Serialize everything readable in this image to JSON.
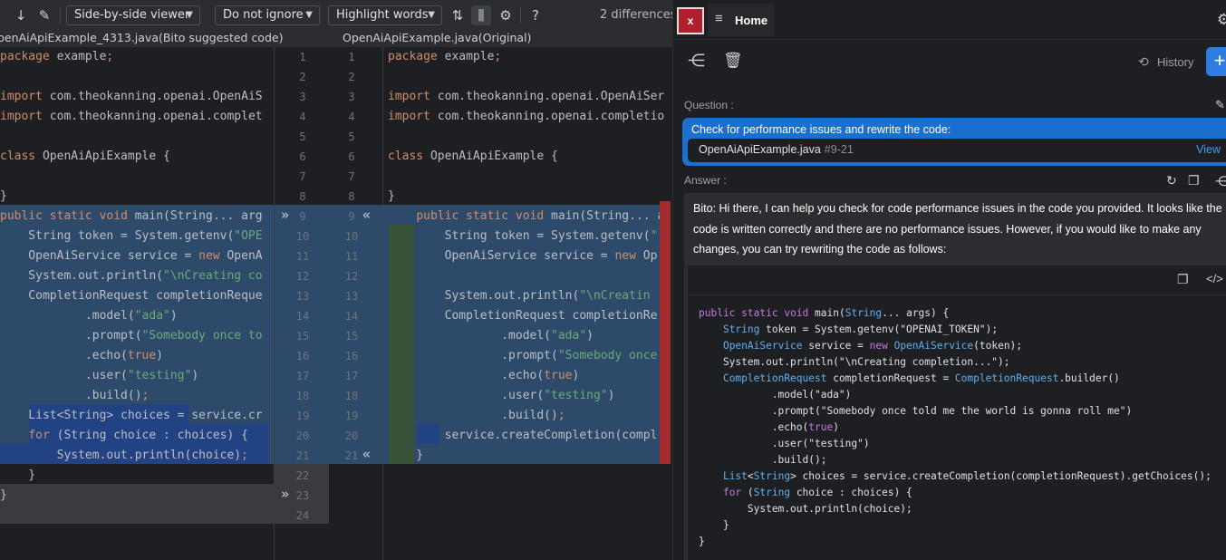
{
  "toolbar": {
    "viewer_select": "Side-by-side viewer",
    "ignore_select": "Do not ignore",
    "highlight_select": "Highlight words",
    "diff_count": "2 differences",
    "help": "?"
  },
  "titles": {
    "left": "penAiApiExample_4313.java(Bito suggested code)",
    "right": "OpenAiApiExample.java(Original)"
  },
  "left_lines": [
    "package example;",
    "",
    "import com.theokanning.openai.OpenAiS",
    "import com.theokanning.openai.complet",
    "",
    "class OpenAiApiExample {",
    "",
    "}",
    "public static void main(String... arg",
    "    String token = System.getenv(\"OPE",
    "    OpenAiService service = new OpenA",
    "    System.out.println(\"\\nCreating co",
    "    CompletionRequest completionReque",
    "            .model(\"ada\")",
    "            .prompt(\"Somebody once to",
    "            .echo(true)",
    "            .user(\"testing\")",
    "            .build();",
    "    List<String> choices = service.cr",
    "    for (String choice : choices) {",
    "        System.out.println(choice);",
    "    }",
    "}"
  ],
  "right_lines": [
    "package example;",
    "",
    "import com.theokanning.openai.OpenAiSer",
    "import com.theokanning.openai.completio",
    "",
    "class OpenAiApiExample {",
    "",
    "}",
    "    public static void main(String... a",
    "        String token = System.getenv(\"",
    "        OpenAiService service = new Op",
    "",
    "        System.out.println(\"\\nCreatin",
    "        CompletionRequest completionRe",
    "                .model(\"ada\")",
    "                .prompt(\"Somebody once",
    "                .echo(true)",
    "                .user(\"testing\")",
    "                .build();",
    "        service.createCompletion(compl",
    "    }"
  ],
  "left_numbers": [
    "1",
    "2",
    "3",
    "4",
    "5",
    "6",
    "7",
    "8",
    "9",
    "10",
    "11",
    "12",
    "13",
    "14",
    "15",
    "16",
    "17",
    "18",
    "19",
    "20",
    "21",
    "22",
    "23",
    "24"
  ],
  "right_numbers": [
    "1",
    "2",
    "3",
    "4",
    "5",
    "6",
    "7",
    "8",
    "9",
    "10",
    "11",
    "12",
    "13",
    "14",
    "15",
    "16",
    "17",
    "18",
    "19",
    "20",
    "21"
  ],
  "chat": {
    "close": "x",
    "home": "Home",
    "history": "History",
    "question_label": "Question :",
    "question": "Check for performance issues and rewrite the code:",
    "file_name": "OpenAiApiExample.java",
    "file_range": "#9-21",
    "view": "View",
    "answer_label": "Answer :",
    "answer_text": "Bito: Hi there, I can help you check for code performance issues in the code you provided. It looks like the code is written correctly and there are no performance issues. However, if you would like to make any changes, you can try rewriting the code as follows:",
    "code": [
      "public static void main(String... args) {",
      "    String token = System.getenv(\"OPENAI_TOKEN\");",
      "    OpenAiService service = new OpenAiService(token);",
      "    System.out.println(\"\\nCreating completion...\");",
      "    CompletionRequest completionRequest = CompletionRequest.builder()",
      "            .model(\"ada\")",
      "            .prompt(\"Somebody once told me the world is gonna roll me\")",
      "            .echo(true)",
      "            .user(\"testing\")",
      "            .build();",
      "    List<String> choices = service.createCompletion(completionRequest).getChoices();",
      "    for (String choice : choices) {",
      "        System.out.println(choice);",
      "    }",
      "}"
    ]
  },
  "colors": {
    "accent": "#2f7de1",
    "question_bg": "#1b6fcf",
    "diff_changed": "#2d4a6b",
    "close_btn": "#b11f2c"
  }
}
